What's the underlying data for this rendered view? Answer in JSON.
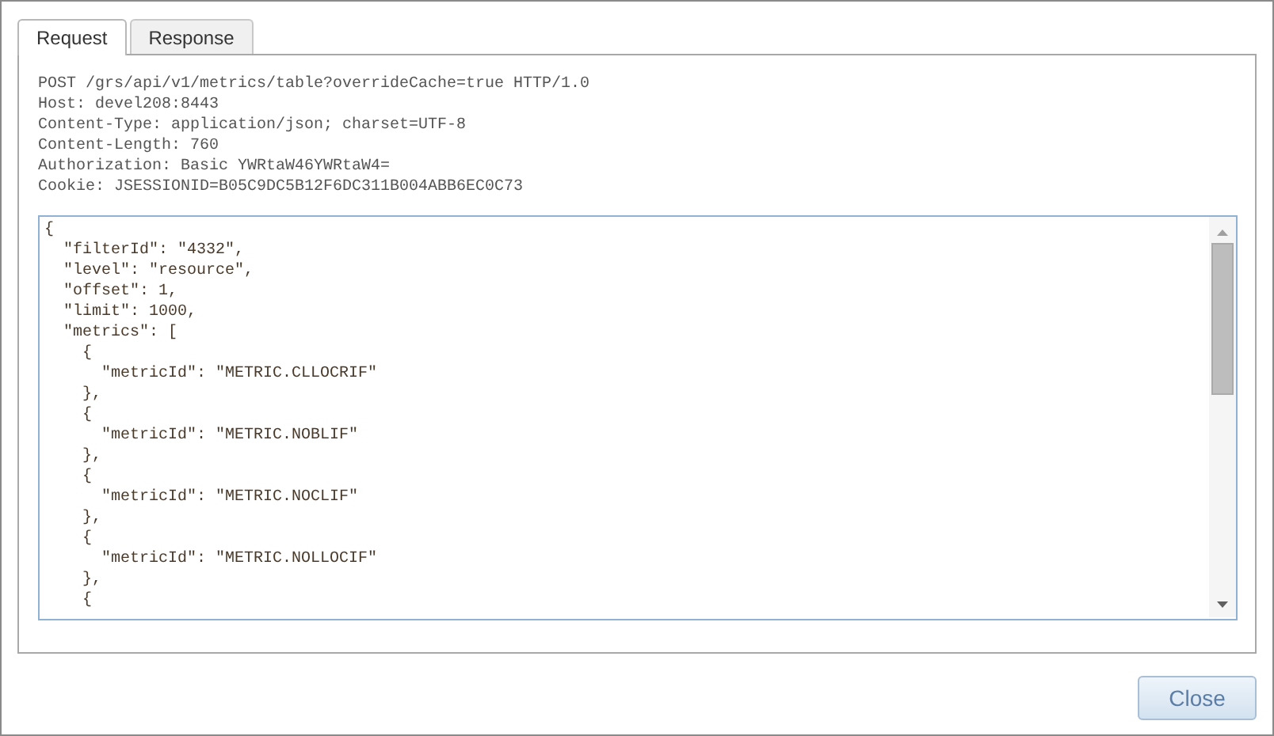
{
  "tabs": [
    {
      "label": "Request",
      "selected": true
    },
    {
      "label": "Response",
      "selected": false
    }
  ],
  "request_headers": [
    "POST /grs/api/v1/metrics/table?overrideCache=true HTTP/1.0",
    "Host: devel208:8443",
    "Content-Type: application/json; charset=UTF-8",
    "Content-Length: 760",
    "Authorization: Basic YWRtaW46YWRtaW4=",
    "Cookie: JSESSIONID=B05C9DC5B12F6DC311B004ABB6EC0C73"
  ],
  "request_body": [
    "{",
    "  \"filterId\": \"4332\",",
    "  \"level\": \"resource\",",
    "  \"offset\": 1,",
    "  \"limit\": 1000,",
    "  \"metrics\": [",
    "    {",
    "      \"metricId\": \"METRIC.CLLOCRIF\"",
    "    },",
    "    {",
    "      \"metricId\": \"METRIC.NOBLIF\"",
    "    },",
    "    {",
    "      \"metricId\": \"METRIC.NOCLIF\"",
    "    },",
    "    {",
    "      \"metricId\": \"METRIC.NOLLOCIF\"",
    "    },",
    "    {"
  ],
  "buttons": [
    {
      "label": "Close"
    }
  ]
}
